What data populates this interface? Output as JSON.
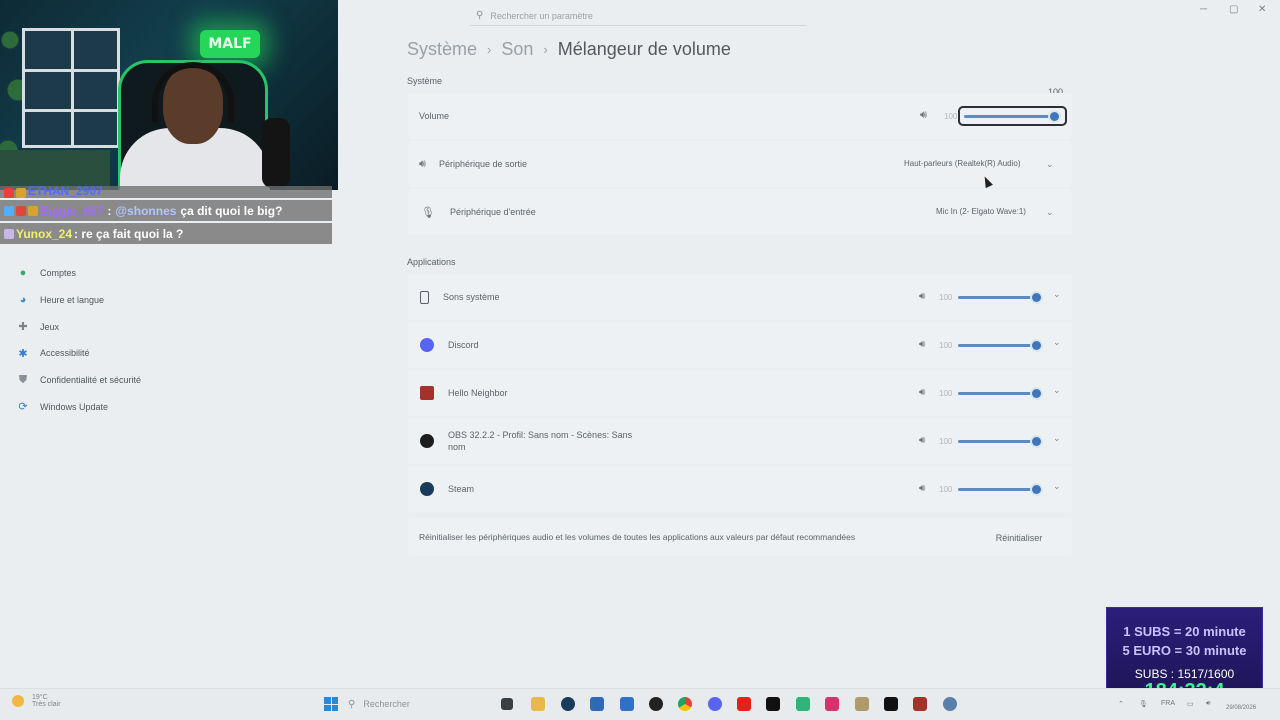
{
  "window": {
    "search_placeholder": "Rechercher un paramètre",
    "controls": {
      "minimize": "─",
      "maximize": "▢",
      "close": "✕"
    }
  },
  "chat": {
    "partial_user": "ETHAN_2907",
    "messages": [
      {
        "user": "Biggie_697",
        "user_color": "#a56bff",
        "mention": "@shonnes",
        "text": "ça dit quoi le big?"
      },
      {
        "user": "Yunox_24",
        "user_color": "#f2f26a",
        "mention": "",
        "text": ": re ça fait quoi la ?"
      }
    ]
  },
  "sidebar": {
    "items": [
      {
        "label": "Comptes",
        "icon": "person-icon",
        "color": "#3aa86e"
      },
      {
        "label": "Heure et langue",
        "icon": "globe-clock-icon",
        "color": "#3c8fcf"
      },
      {
        "label": "Jeux",
        "icon": "gamepad-icon",
        "color": "#7c8287"
      },
      {
        "label": "Accessibilité",
        "icon": "accessibility-icon",
        "color": "#2f7fd4"
      },
      {
        "label": "Confidentialité et sécurité",
        "icon": "shield-icon",
        "color": "#8a9095"
      },
      {
        "label": "Windows Update",
        "icon": "update-icon",
        "color": "#2f7fd4"
      }
    ]
  },
  "breadcrumb": {
    "level1": "Système",
    "level2": "Son",
    "current": "Mélangeur de volume",
    "sep": "›"
  },
  "system": {
    "section_label": "Système",
    "volume": {
      "label": "Volume",
      "value": "100",
      "tooltip": "100",
      "level": 100
    },
    "output": {
      "label": "Périphérique de sortie",
      "value": "Haut-parleurs (Realtek(R) Audio)"
    },
    "input": {
      "label": "Périphérique d'entrée",
      "value": "Mic In (2- Elgato Wave:1)"
    }
  },
  "applications": {
    "section_label": "Applications",
    "items": [
      {
        "name": "Sons système",
        "line2": "",
        "volume": "100",
        "level": 100,
        "icon": "system-sounds-icon"
      },
      {
        "name": "Discord",
        "line2": "",
        "volume": "100",
        "level": 100,
        "icon": "discord-icon"
      },
      {
        "name": "Hello Neighbor",
        "line2": "",
        "volume": "100",
        "level": 100,
        "icon": "hello-neighbor-icon"
      },
      {
        "name": "OBS 32.2.2 - Profil: Sans nom - Scènes: Sans",
        "line2": "nom",
        "volume": "100",
        "level": 100,
        "icon": "obs-icon"
      },
      {
        "name": "Steam",
        "line2": "",
        "volume": "100",
        "level": 100,
        "icon": "steam-icon"
      }
    ]
  },
  "reset": {
    "text": "Réinitialiser les périphériques audio et les volumes de toutes les applications aux valeurs par défaut recommandées",
    "button": "Réinitialiser"
  },
  "subs_overlay": {
    "line1": "1 SUBS = 20 minute",
    "line2": "5 EURO = 30 minute",
    "line3": "SUBS : 1517/1600",
    "timer": "184:32:4"
  },
  "taskbar": {
    "weather_temp": "19°C",
    "weather_desc": "Très clair",
    "search_placeholder": "Rechercher",
    "language": "FRA",
    "date": "29/08/2026"
  },
  "colors": {
    "accent": "#3f78ba",
    "background": "#ebeef0",
    "card": "#eef1f3"
  }
}
